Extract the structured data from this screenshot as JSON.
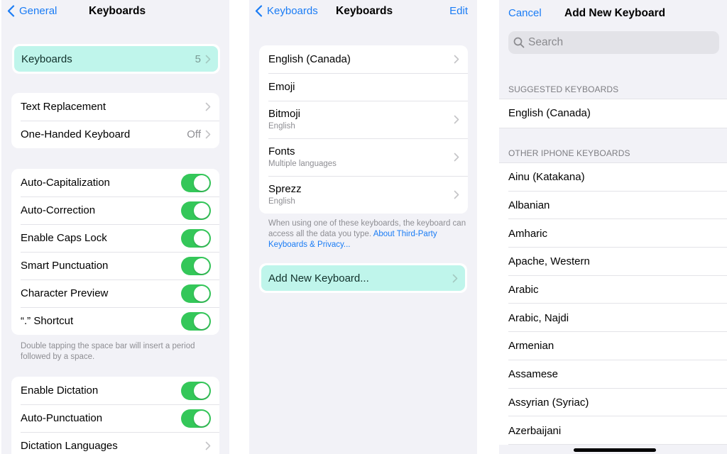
{
  "panel1": {
    "nav": {
      "back_label": "General",
      "title": "Keyboards"
    },
    "keyboards_row": {
      "label": "Keyboards",
      "value": "5"
    },
    "group1": [
      {
        "label": "Text Replacement",
        "value": ""
      },
      {
        "label": "One-Handed Keyboard",
        "value": "Off"
      }
    ],
    "toggles": [
      {
        "label": "Auto-Capitalization",
        "on": true
      },
      {
        "label": "Auto-Correction",
        "on": true
      },
      {
        "label": "Enable Caps Lock",
        "on": true
      },
      {
        "label": "Smart Punctuation",
        "on": true
      },
      {
        "label": "Character Preview",
        "on": true
      },
      {
        "label": "“.” Shortcut",
        "on": true
      }
    ],
    "footnote": "Double tapping the space bar will insert a period followed by a space.",
    "dictation": [
      {
        "label": "Enable Dictation",
        "on": true
      },
      {
        "label": "Auto-Punctuation",
        "on": true
      }
    ],
    "dictation_languages": "Dictation Languages"
  },
  "panel2": {
    "nav": {
      "back_label": "Keyboards",
      "title": "Keyboards",
      "right_label": "Edit"
    },
    "keyboards": [
      {
        "name": "English (Canada)",
        "sub": "",
        "chevron": true
      },
      {
        "name": "Emoji",
        "sub": "",
        "chevron": false
      },
      {
        "name": "Bitmoji",
        "sub": "English",
        "chevron": true
      },
      {
        "name": "Fonts",
        "sub": "Multiple languages",
        "chevron": true
      },
      {
        "name": "Sprezz",
        "sub": "English",
        "chevron": true
      }
    ],
    "footnote_text": "When using one of these keyboards, the keyboard can access all the data you type. ",
    "footnote_link": "About Third-Party Keyboards & Privacy...",
    "add_new": "Add New Keyboard..."
  },
  "panel3": {
    "nav": {
      "cancel_label": "Cancel",
      "title": "Add New Keyboard"
    },
    "search_placeholder": "Search",
    "suggested_header": "SUGGESTED KEYBOARDS",
    "suggested": [
      "English (Canada)"
    ],
    "other_header": "OTHER IPHONE KEYBOARDS",
    "other": [
      "Ainu (Katakana)",
      "Albanian",
      "Amharic",
      "Apache, Western",
      "Arabic",
      "Arabic, Najdi",
      "Armenian",
      "Assamese",
      "Assyrian (Syriac)",
      "Azerbaijani"
    ]
  },
  "colors": {
    "accent": "#1a7cf5",
    "toggle_on": "#34c759",
    "highlight": "#bff5eb",
    "background": "#f2f2f7"
  }
}
